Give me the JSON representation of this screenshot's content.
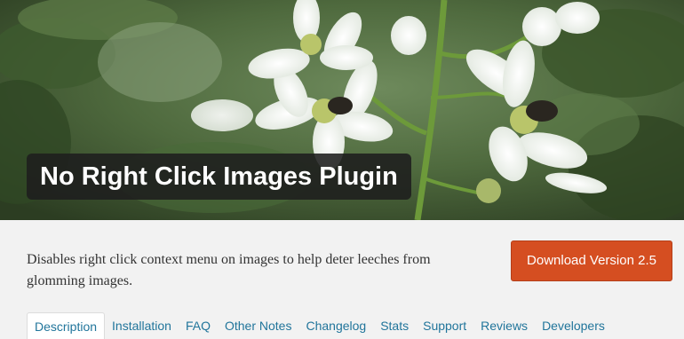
{
  "banner": {
    "title": "No Right Click Images Plugin"
  },
  "description": "Disables right click context menu on images to help deter leeches from glomming images.",
  "download_button": "Download Version 2.5",
  "tabs": [
    {
      "label": "Description",
      "active": true
    },
    {
      "label": "Installation"
    },
    {
      "label": "FAQ"
    },
    {
      "label": "Other Notes"
    },
    {
      "label": "Changelog"
    },
    {
      "label": "Stats"
    },
    {
      "label": "Support"
    },
    {
      "label": "Reviews"
    },
    {
      "label": "Developers"
    }
  ],
  "colors": {
    "accent": "#d54e21",
    "link": "#21759b",
    "background": "#f2f2f2"
  }
}
